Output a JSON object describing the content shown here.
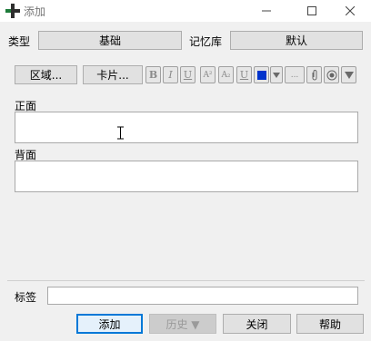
{
  "window": {
    "title": "添加"
  },
  "row1": {
    "type_label": "类型",
    "type_value": "基础",
    "deck_label": "记忆库",
    "deck_value": "默认"
  },
  "toolbar": {
    "fields_button": "区域...",
    "cards_button": "卡片...",
    "bold": "B",
    "italic": "I",
    "underline": "U",
    "superscript": "A²",
    "subscript": "A₂",
    "clear_format": "U",
    "more": "...",
    "color_hex": "#0033cc"
  },
  "fields": [
    {
      "label": "正面"
    },
    {
      "label": "背面"
    }
  ],
  "tags": {
    "label": "标签"
  },
  "buttons": {
    "add": "添加",
    "history": "历史 ▼",
    "close": "关闭",
    "help": "帮助"
  }
}
